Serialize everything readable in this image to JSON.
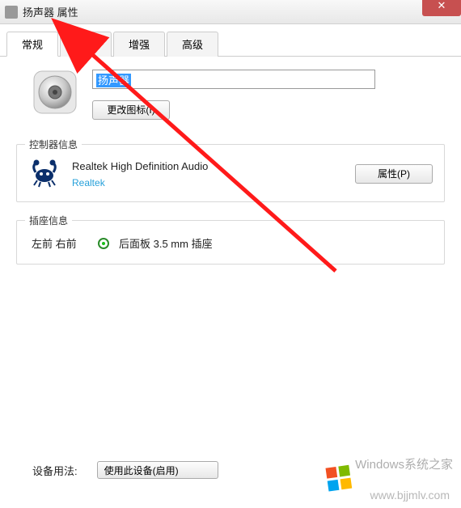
{
  "window": {
    "title": "扬声器 属性"
  },
  "tabs": [
    {
      "label": "常规",
      "active": true
    },
    {
      "label": "级别",
      "active": false
    },
    {
      "label": "增强",
      "active": false
    },
    {
      "label": "高级",
      "active": false
    }
  ],
  "device": {
    "name": "扬声器",
    "change_icon_label": "更改图标(I)"
  },
  "controller": {
    "section_title": "控制器信息",
    "name": "Realtek High Definition Audio",
    "vendor": "Realtek",
    "properties_label": "属性(P)"
  },
  "jack": {
    "section_title": "插座信息",
    "position": "左前 右前",
    "description": "后面板 3.5 mm 插座"
  },
  "usage": {
    "label": "设备用法:",
    "value": "使用此设备(启用)"
  },
  "watermarks": {
    "w1": "Windows系统之家",
    "w2": "www.bjjmlv.com"
  }
}
